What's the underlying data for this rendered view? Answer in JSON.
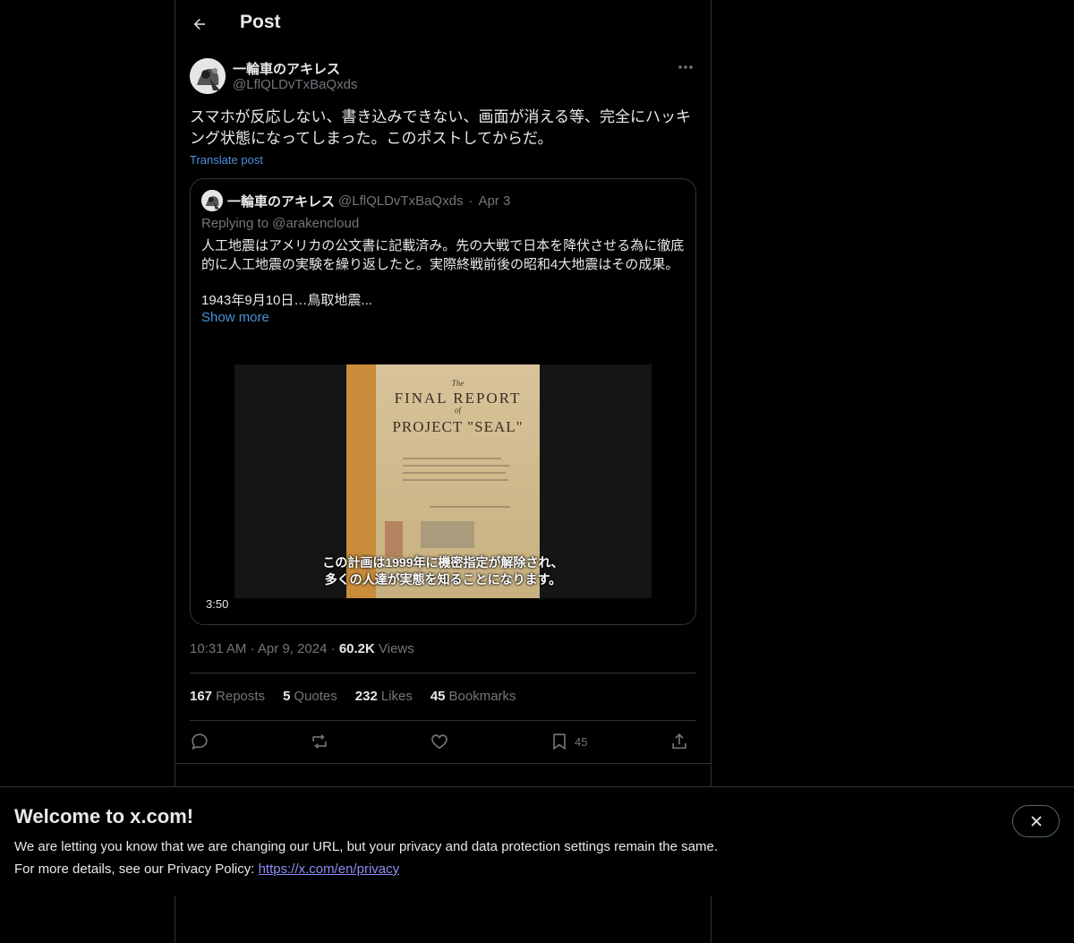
{
  "header": {
    "title": "Post"
  },
  "post": {
    "author_name": "一輪車のアキレス",
    "author_handle": "@LflQLDvTxBaQxds",
    "text": "スマホが反応しない、書き込みできない、画面が消える等、完全にハッキング状態になってしまった。このポストしてからだ。",
    "translate_label": "Translate post",
    "time": "10:31 AM",
    "date": "Apr 9, 2024",
    "views_count": "60.2K",
    "views_label": "Views"
  },
  "quote": {
    "author_name": "一輪車のアキレス",
    "author_handle": "@LflQLDvTxBaQxds",
    "date": "Apr 3",
    "replying_to": "Replying to @arakencloud",
    "text": "人工地震はアメリカの公文書に記載済み。先の大戦で日本を降伏させる為に徹底的に人工地震の実験を繰り返したと。実際終戦前後の昭和4大地震はその成果。",
    "text2": "1943年9月10日…鳥取地震...",
    "show_more": "Show more",
    "video": {
      "doc_the": "The",
      "doc_title1": "FINAL REPORT",
      "doc_of": "of",
      "doc_title2": "PROJECT \"SEAL\"",
      "subtitle1": "この計画は1999年に機密指定が解除され、",
      "subtitle2": "多くの人達が実態を知ることになります。",
      "duration": "3:50"
    }
  },
  "stats": [
    {
      "count": "167",
      "label": "Reposts"
    },
    {
      "count": "5",
      "label": "Quotes"
    },
    {
      "count": "232",
      "label": "Likes"
    },
    {
      "count": "45",
      "label": "Bookmarks"
    }
  ],
  "actions": {
    "reply_icon": "reply-icon",
    "repost_icon": "repost-icon",
    "like_icon": "heart-icon",
    "bookmark_icon": "bookmark-icon",
    "bookmark_count": "45",
    "share_icon": "share-icon"
  },
  "banner": {
    "title": "Welcome to x.com!",
    "line1": "We are letting you know that we are changing our URL, but your privacy and data protection settings remain the same.",
    "line2_prefix": "For more details, see our Privacy Policy: ",
    "link": "https://x.com/en/privacy"
  },
  "colors": {
    "background": "#000000",
    "accent": "#1d9bf0",
    "link": "#8e8cf5",
    "muted": "#71767b"
  }
}
